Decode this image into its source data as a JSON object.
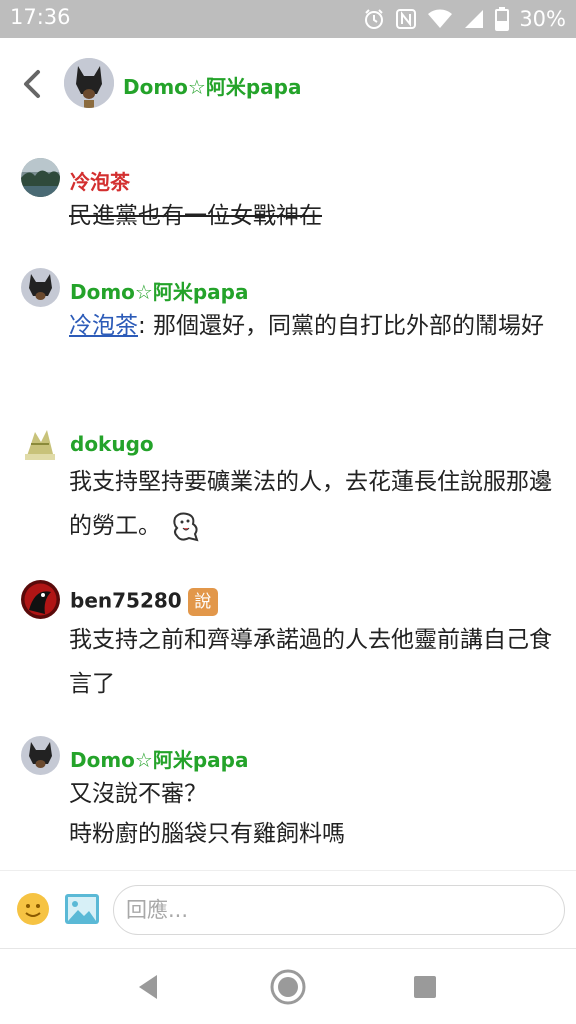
{
  "status_bar": {
    "time": "17:36",
    "battery": "30%",
    "icons": [
      "alarm-icon",
      "nfc-icon",
      "wifi-icon",
      "signal-icon",
      "battery-icon"
    ]
  },
  "header": {
    "back_icon": "chevron-left-icon",
    "title": "Domo☆阿米papa",
    "title_color": "#24a32a"
  },
  "comments": [
    {
      "author": "冷泡茶",
      "author_color": "#d32f2f",
      "text": "民進黨也有一位女戰神在",
      "strikethrough": true
    },
    {
      "author": "Domo☆阿米papa",
      "author_color": "#24a32a",
      "mention": "冷泡茶",
      "text": ": 那個還好，同黨的自打比外部的鬧場好"
    },
    {
      "author": "dokugo",
      "author_color": "#24a32a",
      "text": "我支持堅持要礦業法的人，去花蓮長住說服那邊的勞工。",
      "sticker": "tongue-sticker-icon"
    },
    {
      "author": "ben75280",
      "author_color": "#222222",
      "badge": "說",
      "badge_color": "#e2974a",
      "text": "我支持之前和齊導承諾過的人去他靈前講自己食言了"
    },
    {
      "author": "Domo☆阿米papa",
      "author_color": "#24a32a",
      "text_line1": "又沒說不審？",
      "text_line2": "時粉廚的腦袋只有雞飼料嗎"
    }
  ],
  "composer": {
    "placeholder": "回應...",
    "emoji_icon": "smiley-icon",
    "image_icon": "image-icon"
  },
  "nav_bar": {
    "buttons": [
      "back-triangle-icon",
      "home-circle-icon",
      "recents-square-icon"
    ]
  }
}
